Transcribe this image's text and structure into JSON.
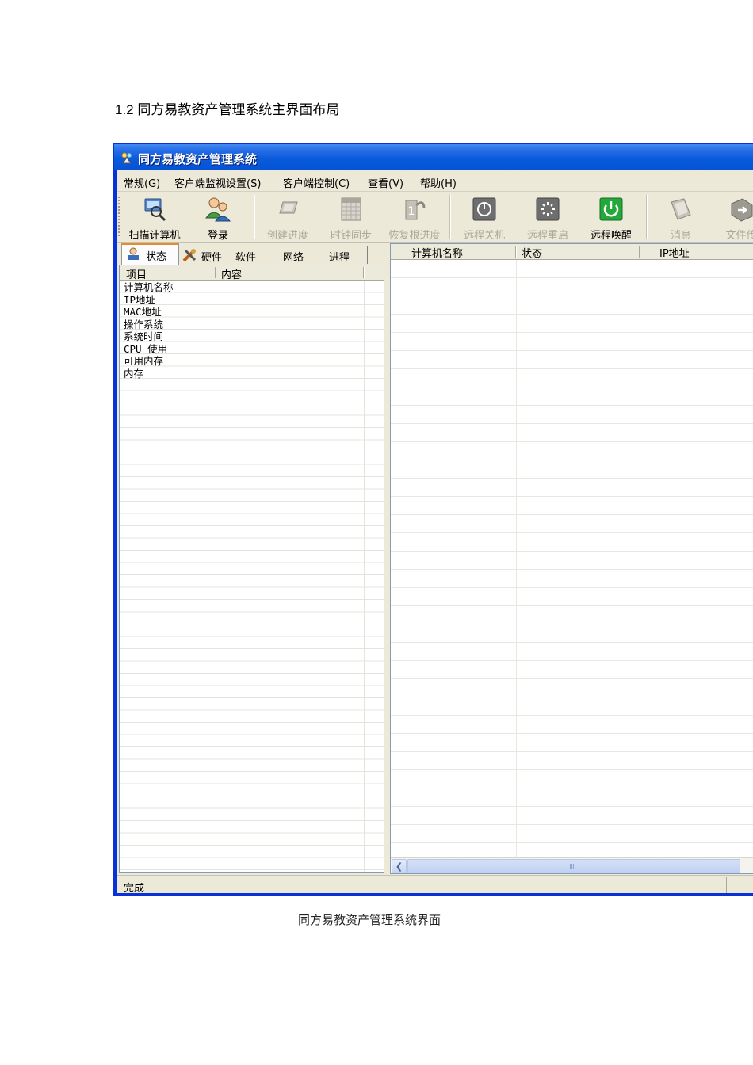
{
  "heading": "1.2 同方易教资产管理系统主界面布局",
  "window": {
    "title": "同方易教资产管理系统"
  },
  "menu": [
    "常规(G)",
    "客户端监视设置(S)",
    "客户端控制(C)",
    "查看(V)",
    "帮助(H)"
  ],
  "toolbar": [
    {
      "label": "扫描计算机",
      "icon": "scan-computer-icon",
      "enabled": true
    },
    {
      "label": "登录",
      "icon": "users-login-icon",
      "enabled": true
    },
    {
      "label": "创建进度",
      "icon": "create-progress-icon",
      "enabled": false
    },
    {
      "label": "时钟同步",
      "icon": "clock-sync-icon",
      "enabled": false
    },
    {
      "label": "恢复根进度",
      "icon": "restore-root-icon",
      "enabled": false
    },
    {
      "label": "远程关机",
      "icon": "remote-shutdown-icon",
      "enabled": false
    },
    {
      "label": "远程重启",
      "icon": "remote-restart-icon",
      "enabled": false
    },
    {
      "label": "远程唤醒",
      "icon": "remote-wake-icon",
      "enabled": true
    },
    {
      "label": "消息",
      "icon": "message-icon",
      "enabled": false
    },
    {
      "label": "文件传",
      "icon": "file-transfer-icon",
      "enabled": false
    }
  ],
  "tabs": [
    "状态",
    "硬件",
    "软件",
    "网络",
    "进程"
  ],
  "left_table": {
    "columns": [
      "项目",
      "内容"
    ],
    "rows": [
      "计算机名称",
      "IP地址",
      "MAC地址",
      "操作系统",
      "系统时间",
      "CPU 使用",
      "可用内存",
      "内存"
    ]
  },
  "right_table": {
    "columns": [
      "计算机名称",
      "状态",
      "IP地址"
    ]
  },
  "status": "完成",
  "caption": "同方易教资产管理系统界面"
}
